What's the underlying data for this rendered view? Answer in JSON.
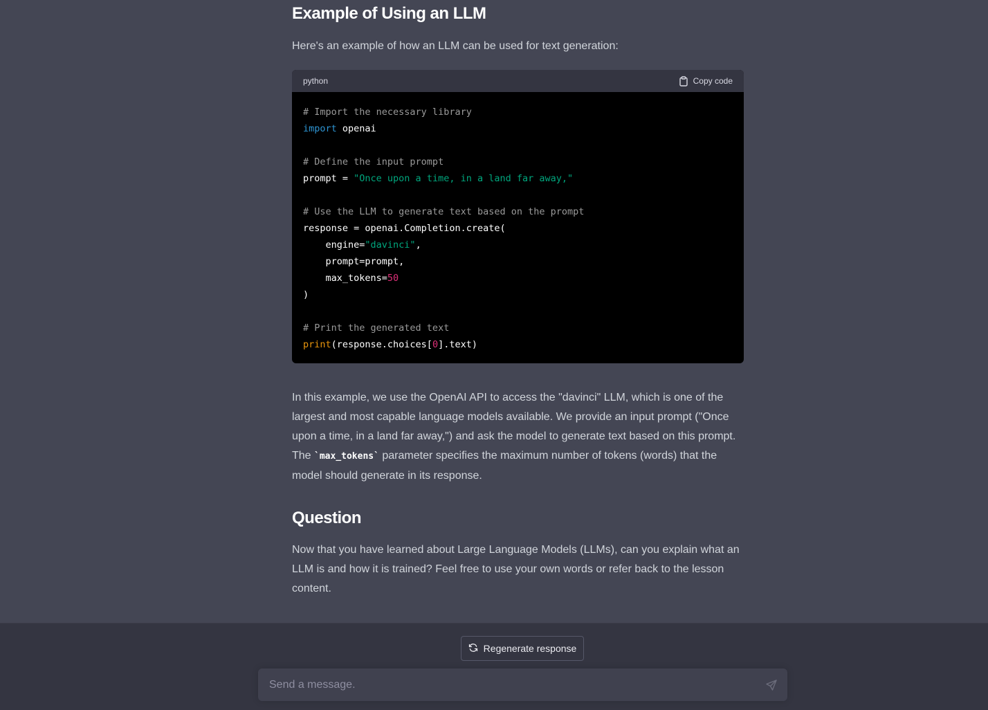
{
  "section1": {
    "heading": "Example of Using an LLM",
    "intro": "Here's an example of how an LLM can be used for text generation:"
  },
  "codeblock": {
    "language": "python",
    "copy_label": "Copy code",
    "lines": [
      "# Import the necessary library",
      "import openai",
      "",
      "# Define the input prompt",
      "prompt = \"Once upon a time, in a land far away,\"",
      "",
      "# Use the LLM to generate text based on the prompt",
      "response = openai.Completion.create(",
      "    engine=\"davinci\",",
      "    prompt=prompt,",
      "    max_tokens=50",
      ")",
      "",
      "# Print the generated text",
      "print(response.choices[0].text)"
    ]
  },
  "explanation": {
    "text_before": "In this example, we use the OpenAI API to access the \"davinci\" LLM, which is one of the largest and most capable language models available. We provide an input prompt (\"Once upon a time, in a land far away,\") and ask the model to generate text based on this prompt. The ",
    "inline_code": "`max_tokens`",
    "text_after": " parameter specifies the maximum number of tokens (words) that the model should generate in its response."
  },
  "section2": {
    "heading": "Question",
    "text": "Now that you have learned about Large Language Models (LLMs), can you explain what an LLM is and how it is trained? Feel free to use your own words or refer back to the lesson content."
  },
  "bottom": {
    "regenerate_label": "Regenerate response",
    "input_placeholder": "Send a message."
  }
}
